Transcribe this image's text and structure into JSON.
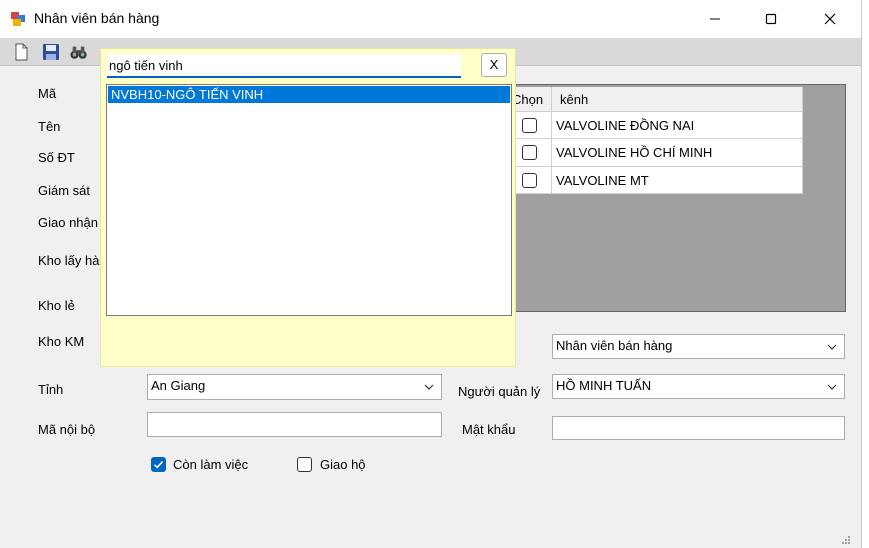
{
  "window": {
    "title": "Nhân viên bán hàng",
    "icons": {
      "app": "app-form-icon",
      "minimize": "minimize-icon",
      "maximize": "maximize-icon",
      "close": "close-icon"
    }
  },
  "toolbar": {
    "icons": [
      "new-document-icon",
      "save-icon",
      "find-binoculars-icon"
    ]
  },
  "form": {
    "labels": {
      "ma": "Mã",
      "ten": "Tên",
      "so_dt": "Số ĐT",
      "giam_sat": "Giám sát",
      "giao_nhan": "Giao nhận",
      "kho_lay_hang": "Kho lấy hàn",
      "kho_le": "Kho lẻ",
      "kho_km": "Kho KM",
      "tinh": "Tỉnh",
      "ma_noi_bo": "Mã nội bộ",
      "nguoi_quan_ly": "Người quản lý",
      "mat_khau": "Mật khẩu"
    },
    "tinh_value": "An Giang",
    "chuc_vu_value": "Nhân viên bán hàng",
    "nguoi_quan_ly_value": "HỒ MINH TUẤN",
    "ma_noi_bo_value": "",
    "mat_khau_value": "",
    "con_lam_viec": {
      "label": "Còn làm việc",
      "checked": true
    },
    "giao_ho": {
      "label": "Giao hộ",
      "checked": false
    }
  },
  "grid": {
    "headers": {
      "chon": "Chọn",
      "kenh": "kênh"
    },
    "rows": [
      {
        "chon": false,
        "kenh": "VALVOLINE ĐỒNG NAI"
      },
      {
        "chon": false,
        "kenh": "VALVOLINE HỒ CHÍ MINH"
      },
      {
        "chon": false,
        "kenh": "VALVOLINE MT"
      }
    ]
  },
  "popup": {
    "search_value": "ngô tiến vinh",
    "close_label": "X",
    "results": [
      "NVBH10-NGÔ TIẾN VINH"
    ],
    "selected_index": 0
  },
  "colors": {
    "accent": "#0067c0",
    "selection": "#0078d7",
    "popup_bg": "#ffffc8",
    "grid_bg": "#a0a0a0"
  }
}
